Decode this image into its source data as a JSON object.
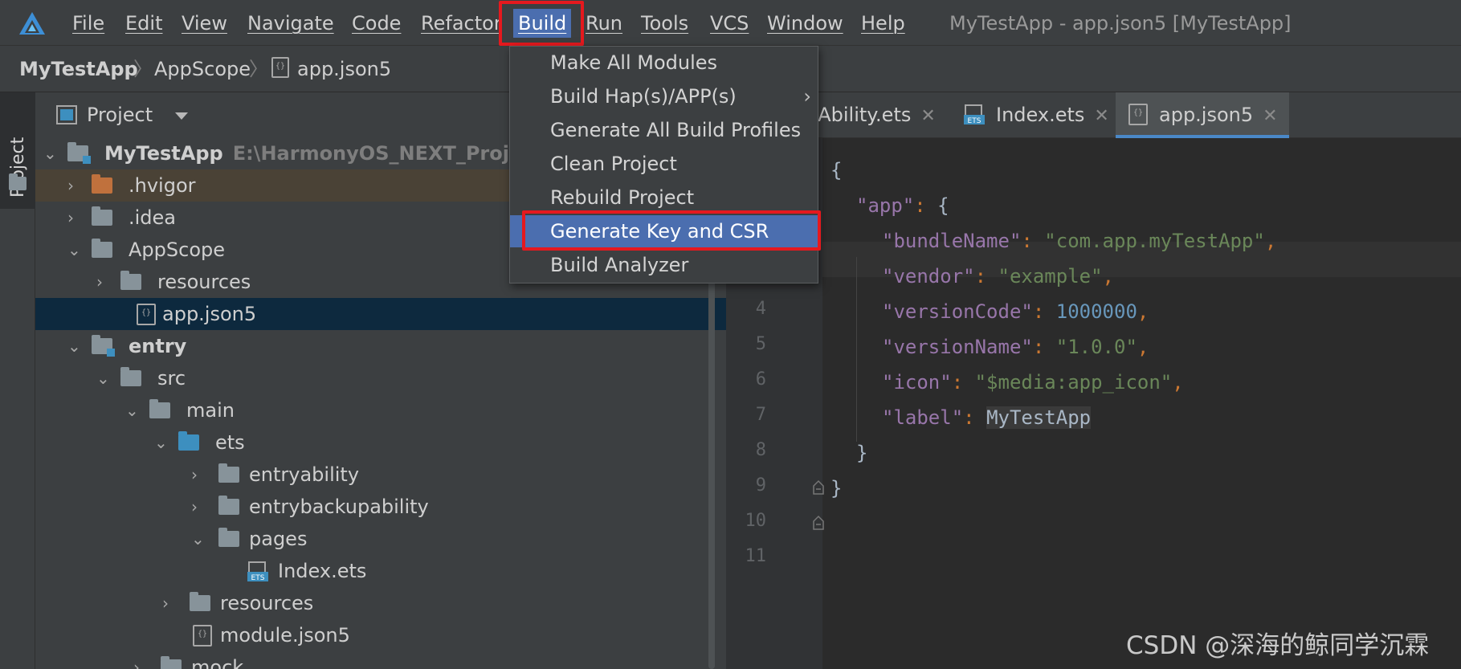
{
  "menubar": {
    "items": [
      "File",
      "Edit",
      "View",
      "Navigate",
      "Code",
      "Refactor",
      "Build",
      "Run",
      "Tools",
      "VCS",
      "Window",
      "Help"
    ],
    "active": "Build",
    "window_title": "MyTestApp - app.json5 [MyTestApp]"
  },
  "breadcrumb": [
    "MyTestApp",
    "AppScope",
    "app.json5"
  ],
  "toolstrip": {
    "project_label": "Project"
  },
  "project_panel": {
    "title": "Project",
    "tree": [
      {
        "label": "MyTestApp",
        "path": "E:\\HarmonyOS_NEXT_Project\\M",
        "icon": "module-folder-icon"
      },
      {
        "label": ".hvigor",
        "icon": "folder-orange-icon"
      },
      {
        "label": ".idea",
        "icon": "folder-icon"
      },
      {
        "label": "AppScope",
        "icon": "folder-icon"
      },
      {
        "label": "resources",
        "icon": "folder-icon"
      },
      {
        "label": "app.json5",
        "icon": "json-file-icon"
      },
      {
        "label": "entry",
        "icon": "module-folder-icon"
      },
      {
        "label": "src",
        "icon": "folder-icon"
      },
      {
        "label": "main",
        "icon": "folder-icon"
      },
      {
        "label": "ets",
        "icon": "folder-blue-icon"
      },
      {
        "label": "entryability",
        "icon": "folder-icon"
      },
      {
        "label": "entrybackupability",
        "icon": "folder-icon"
      },
      {
        "label": "pages",
        "icon": "folder-icon"
      },
      {
        "label": "Index.ets",
        "icon": "ets-file-icon"
      },
      {
        "label": "resources",
        "icon": "folder-icon"
      },
      {
        "label": "module.json5",
        "icon": "json-file-icon"
      },
      {
        "label": "mock",
        "icon": "folder-icon"
      }
    ]
  },
  "editor_tabs": [
    {
      "label": "yAbility.ets"
    },
    {
      "label": "Index.ets"
    },
    {
      "label": "app.json5"
    }
  ],
  "editor": {
    "line_numbers": [
      "4",
      "5",
      "6",
      "7",
      "8",
      "9",
      "10",
      "11"
    ],
    "code": {
      "brace_open": "{",
      "app_key": "\"app\"",
      "bundle_key": "\"bundleName\"",
      "bundle_val": "\"com.app.myTestApp\"",
      "vendor_key": "\"vendor\"",
      "vendor_val": "\"example\"",
      "vcode_key": "\"versionCode\"",
      "vcode_val": "1000000",
      "vname_key": "\"versionName\"",
      "vname_val": "\"1.0.0\"",
      "icon_key": "\"icon\"",
      "icon_val": "\"$media:app_icon\"",
      "label_key": "\"label\"",
      "label_val": "MyTestApp",
      "brace_close": "}"
    }
  },
  "build_menu": {
    "items": [
      "Make All Modules",
      "Build Hap(s)/APP(s)",
      "Generate All Build Profiles",
      "Clean Project",
      "Rebuild Project",
      "Generate Key and CSR",
      "Build Analyzer"
    ],
    "selected": "Generate Key and CSR",
    "submenu_arrow": "›"
  },
  "watermark": "CSDN @深海的鲸同学沉霖",
  "colors": {
    "accent": "#4b6eaf",
    "highlight_box": "#e5191e"
  }
}
